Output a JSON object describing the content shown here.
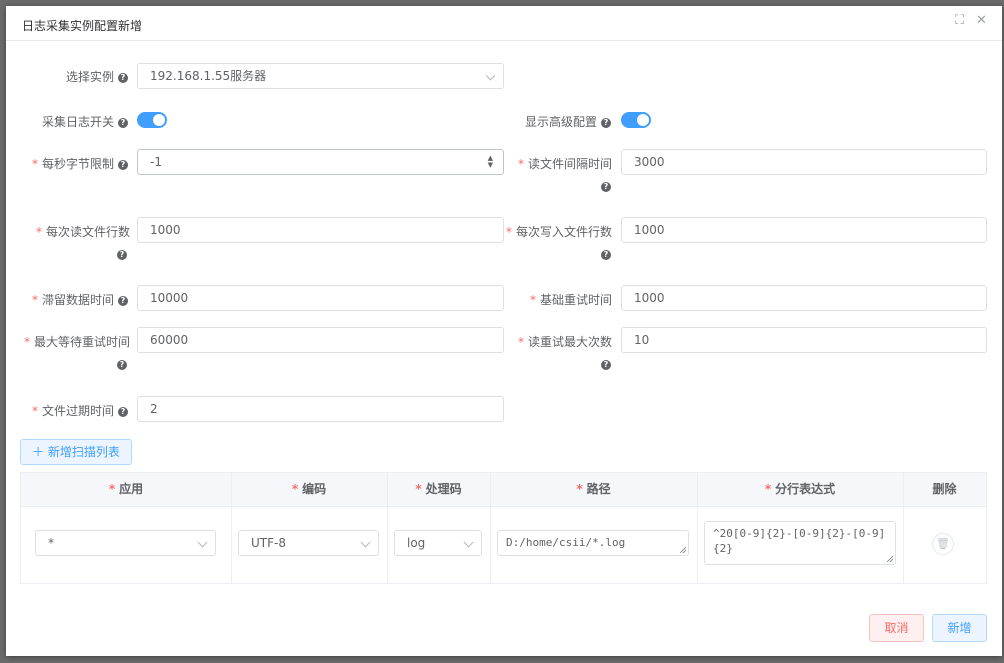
{
  "dialog": {
    "title": "日志采集实例配置新增",
    "fullscreen_icon": "fullscreen-icon",
    "close_icon": "close-icon"
  },
  "form": {
    "instance": {
      "label": "选择实例",
      "value": "192.168.1.55服务器"
    },
    "collect_switch": {
      "label": "采集日志开关",
      "on": true
    },
    "advanced_switch": {
      "label": "显示高级配置",
      "on": true
    },
    "bytes_limit": {
      "label": "每秒字节限制",
      "value": "-1"
    },
    "read_interval": {
      "label": "读文件间隔时间",
      "value": "3000"
    },
    "lines_per_read": {
      "label": "每次读文件行数",
      "value": "1000"
    },
    "lines_per_write": {
      "label": "每次写入文件行数",
      "value": "1000"
    },
    "retention_time": {
      "label": "滞留数据时间",
      "value": "10000"
    },
    "base_retry": {
      "label": "基础重试时间",
      "value": "1000"
    },
    "max_wait_retry": {
      "label": "最大等待重试时间",
      "value": "60000"
    },
    "max_read_retry": {
      "label": "读重试最大次数",
      "value": "10"
    },
    "file_expire": {
      "label": "文件过期时间",
      "value": "2"
    }
  },
  "scan": {
    "add_label": "新增扫描列表",
    "columns": [
      "应用",
      "编码",
      "处理码",
      "路径",
      "分行表达式",
      "删除"
    ],
    "row": {
      "app": "*",
      "encoding": "UTF-8",
      "handler": "log",
      "path": "D:/home/csii/*.log",
      "regex": "^20[0-9]{2}-[0-9]{2}-[0-9]{2}"
    }
  },
  "footer": {
    "cancel": "取消",
    "submit": "新增"
  },
  "colors": {
    "primary": "#409eff",
    "danger": "#f56c6c",
    "required": "#f56c6c"
  }
}
